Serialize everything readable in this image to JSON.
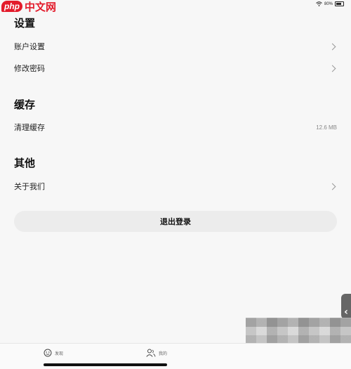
{
  "watermark": {
    "brand": "php",
    "text": "中文网"
  },
  "status_bar": {
    "battery": "80%"
  },
  "sections": {
    "settings": {
      "title": "设置",
      "account": "账户设置",
      "password": "修改密码"
    },
    "cache": {
      "title": "缓存",
      "clear": "清理缓存",
      "size": "12.6 MB"
    },
    "other": {
      "title": "其他",
      "about": "关于我们"
    }
  },
  "logout_label": "退出登录",
  "tabs": {
    "discover": "发现",
    "mine": "我的"
  }
}
